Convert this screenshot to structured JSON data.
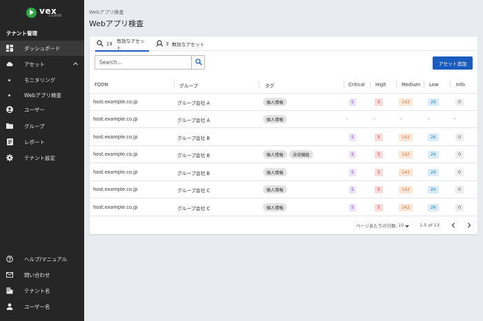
{
  "brand": {
    "name": "vex",
    "sub": "CLOUD",
    "accent": "#2fa64a"
  },
  "sidebar": {
    "heading": "テナント管理",
    "items": [
      {
        "label": "ダッシュボード",
        "icon": "dashboard-icon",
        "active": true
      },
      {
        "label": "アセット",
        "icon": "cloud-icon"
      },
      {
        "label": "モニタリング"
      },
      {
        "label": "Webアプリ検査"
      },
      {
        "label": "ユーザー",
        "icon": "user-circle-icon"
      },
      {
        "label": "グループ",
        "icon": "folder-icon"
      },
      {
        "label": "レポート",
        "icon": "report-icon"
      },
      {
        "label": "テナント設定",
        "icon": "gear-icon"
      }
    ],
    "bottom": [
      {
        "label": "ヘルプ/マニュアル",
        "icon": "help-icon"
      },
      {
        "label": "問い合わせ",
        "icon": "mail-icon"
      },
      {
        "label": "テナント名",
        "icon": "building-icon"
      },
      {
        "label": "ユーザー名",
        "icon": "person-icon"
      }
    ]
  },
  "header": {
    "breadcrumb": "Webアプリ検査",
    "title": "Webアプリ検査"
  },
  "tabs": [
    {
      "count": "19",
      "label": "有効なアセット",
      "icon": "search-icon",
      "active": true
    },
    {
      "count": "3",
      "label": "無効なアセット",
      "icon": "search-off-icon"
    }
  ],
  "search": {
    "placeholder": "Search...",
    "value": ""
  },
  "add_button": "アセット追加",
  "table": {
    "columns": [
      "FQDN",
      "グループ",
      "タグ",
      "Critical",
      "High",
      "Medium",
      "Low",
      "Info"
    ],
    "rows": [
      {
        "fqdn": "host.example.co.jp",
        "group": "グループ会社 A",
        "tags": [
          "個人情報"
        ],
        "critical": "5",
        "high": "5",
        "medium": "142",
        "low": "26",
        "info": "0"
      },
      {
        "fqdn": "host.example.co.jp",
        "group": "グループ会社 A",
        "tags": [
          "個人情報"
        ],
        "critical": "-",
        "high": "-",
        "medium": "-",
        "low": "-",
        "info": "-"
      },
      {
        "fqdn": "host.example.co.jp",
        "group": "グループ会社 B",
        "tags": [],
        "critical": "5",
        "high": "5",
        "medium": "142",
        "low": "26",
        "info": "0"
      },
      {
        "fqdn": "host.example.co.jp",
        "group": "グループ会社 B",
        "tags": [
          "個人情報",
          "決済機能"
        ],
        "critical": "5",
        "high": "5",
        "medium": "142",
        "low": "26",
        "info": "0"
      },
      {
        "fqdn": "host.example.co.jp",
        "group": "グループ会社 B",
        "tags": [
          "個人情報"
        ],
        "critical": "5",
        "high": "5",
        "medium": "142",
        "low": "26",
        "info": "0"
      },
      {
        "fqdn": "host.example.co.jp",
        "group": "グループ会社 C",
        "tags": [
          "個人情報"
        ],
        "critical": "5",
        "high": "5",
        "medium": "142",
        "low": "26",
        "info": "0"
      },
      {
        "fqdn": "host.example.co.jp",
        "group": "グループ会社 C",
        "tags": [
          "個人情報"
        ],
        "critical": "5",
        "high": "5",
        "medium": "142",
        "low": "26",
        "info": "0"
      }
    ]
  },
  "severity_colors": {
    "critical": {
      "bg": "#ece3f7",
      "fg": "#7b4ab0"
    },
    "high": {
      "bg": "#fadcdc",
      "fg": "#c23b3b"
    },
    "medium": {
      "bg": "#fde6d6",
      "fg": "#d27a3c"
    },
    "low": {
      "bg": "#d9ecf8",
      "fg": "#2e86c1"
    },
    "info": {
      "bg": "#eeeeee",
      "fg": "#555555"
    }
  },
  "pagination": {
    "rows_per_page_label": "ページあたりの行数:",
    "rows_per_page": "10",
    "range": "1-5 of 13"
  }
}
